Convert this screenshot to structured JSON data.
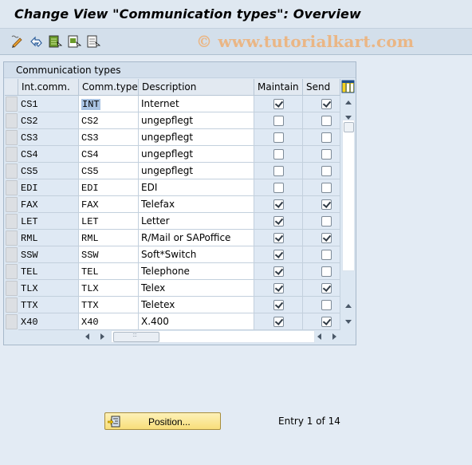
{
  "window": {
    "title": "Change View \"Communication types\": Overview",
    "watermark": "© www.tutorialkart.com"
  },
  "toolbar": {
    "icons": [
      "display-change-icon",
      "undo-icon",
      "select-all-icon",
      "select-block-icon",
      "deselect-all-icon"
    ]
  },
  "table": {
    "title": "Communication types",
    "columns": [
      "Int.comm.",
      "Comm.type",
      "Description",
      "Maintain",
      "Send"
    ],
    "rows": [
      {
        "int_comm": "CS1",
        "comm_type": "INT",
        "description": "Internet",
        "maintain": true,
        "send": true
      },
      {
        "int_comm": "CS2",
        "comm_type": "CS2",
        "description": "ungepflegt",
        "maintain": false,
        "send": false
      },
      {
        "int_comm": "CS3",
        "comm_type": "CS3",
        "description": "ungepflegt",
        "maintain": false,
        "send": false
      },
      {
        "int_comm": "CS4",
        "comm_type": "CS4",
        "description": "ungepflegt",
        "maintain": false,
        "send": false
      },
      {
        "int_comm": "CS5",
        "comm_type": "CS5",
        "description": "ungepflegt",
        "maintain": false,
        "send": false
      },
      {
        "int_comm": "EDI",
        "comm_type": "EDI",
        "description": "EDI",
        "maintain": false,
        "send": false
      },
      {
        "int_comm": "FAX",
        "comm_type": "FAX",
        "description": "Telefax",
        "maintain": true,
        "send": true
      },
      {
        "int_comm": "LET",
        "comm_type": "LET",
        "description": "Letter",
        "maintain": true,
        "send": false
      },
      {
        "int_comm": "RML",
        "comm_type": "RML",
        "description": "R/Mail or SAPoffice",
        "maintain": true,
        "send": true
      },
      {
        "int_comm": "SSW",
        "comm_type": "SSW",
        "description": "Soft*Switch",
        "maintain": true,
        "send": false
      },
      {
        "int_comm": "TEL",
        "comm_type": "TEL",
        "description": "Telephone",
        "maintain": true,
        "send": false
      },
      {
        "int_comm": "TLX",
        "comm_type": "TLX",
        "description": "Telex",
        "maintain": true,
        "send": true
      },
      {
        "int_comm": "TTX",
        "comm_type": "TTX",
        "description": "Teletex",
        "maintain": true,
        "send": false
      },
      {
        "int_comm": "X40",
        "comm_type": "X40",
        "description": "X.400",
        "maintain": true,
        "send": true
      }
    ]
  },
  "footer": {
    "position_button": "Position...",
    "entry_text": "Entry 1 of 14"
  }
}
